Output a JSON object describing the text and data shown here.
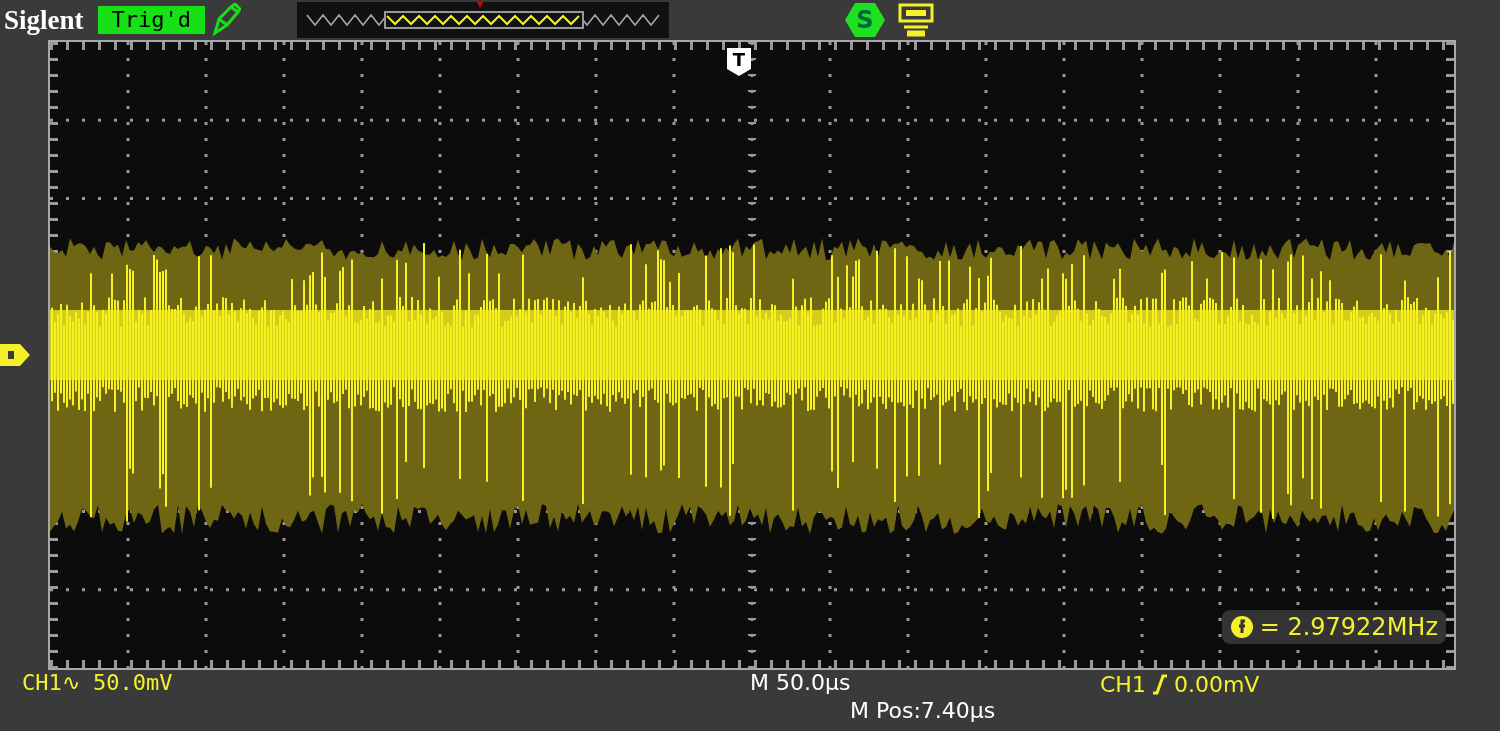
{
  "header": {
    "brand": "Siglent",
    "trigger_status": "Trig'd",
    "status_badge": "S"
  },
  "screen": {
    "trigger_marker": "T",
    "frequency_readout": "= 2.97922MHz"
  },
  "footer": {
    "channel_scale": "CH1∿ 50.0mV",
    "timebase": "M 50.0μs",
    "time_position": "M Pos:7.40μs",
    "trigger_source": "CH1",
    "trigger_level": "0.00mV"
  }
}
